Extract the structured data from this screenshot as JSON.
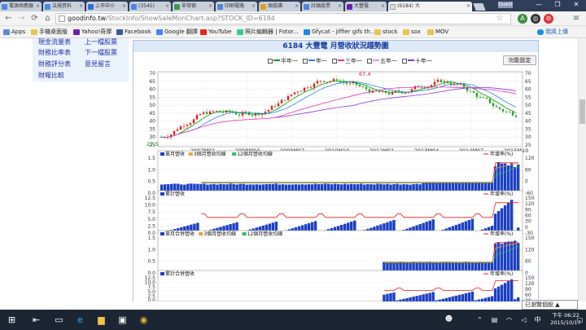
{
  "tabs": [
    {
      "label": "電源供應器"
    },
    {
      "label": "法規資料"
    },
    {
      "label": "上市中小"
    },
    {
      "label": "(3545)"
    },
    {
      "label": "非常宿"
    },
    {
      "label": "印刷電路"
    },
    {
      "label": "換股讀"
    },
    {
      "label": "討論股票"
    },
    {
      "label": "大豐電"
    },
    {
      "label": "(6184) 大"
    }
  ],
  "user_chip": "Guest",
  "window_controls": {
    "minimize": "—",
    "maximize": "❐",
    "close": "✕"
  },
  "address": {
    "host": "goodinfo.tw",
    "path": "/StockInfo/ShowSaleMonChart.asp?STOCK_ID=6184"
  },
  "toolbar_extra": {
    "sync_label": "我將上傳"
  },
  "bookmarks": [
    {
      "label": "Apps"
    },
    {
      "label": "手機桌面版"
    },
    {
      "label": "Yahoo!奇摩"
    },
    {
      "label": "Facebook"
    },
    {
      "label": "Google 翻譯"
    },
    {
      "label": "YouTube"
    },
    {
      "label": "照片編輯器 | Fotor..."
    },
    {
      "label": "Gfycat - jiffier gifs th..."
    },
    {
      "label": "stock"
    },
    {
      "label": "sox"
    },
    {
      "label": "MOV"
    }
  ],
  "sidebar": {
    "links": [
      {
        "label": "現金流量表"
      },
      {
        "label": "上一檔股票"
      },
      {
        "label": "財務比率表"
      },
      {
        "label": "下一檔股票"
      },
      {
        "label": "財務評分表"
      },
      {
        "label": "意見留言"
      },
      {
        "label": "財報比較"
      }
    ]
  },
  "chart": {
    "title": "6184 大豐電 月營收狀況趨勢圖",
    "settings_label": "功能設定",
    "legend": [
      {
        "label": "半年一",
        "color": "#009900"
      },
      {
        "label": "年一",
        "color": "#2a7fe0"
      },
      {
        "label": "三年一",
        "color": "#dd33aa"
      },
      {
        "label": "五年一",
        "color": "#d9a0d0"
      },
      {
        "label": "十年一",
        "color": "#8833dd"
      }
    ],
    "price_max_label": "67.4",
    "price_min_label": "27.5",
    "date_ticks": [
      "2007M01",
      "2008M04",
      "2009M07",
      "2010M10",
      "2012M01",
      "2013M04",
      "2014M07",
      "2015M10"
    ],
    "y_ticks_main": [
      "70",
      "65",
      "60",
      "55",
      "50",
      "45",
      "40",
      "35",
      "30",
      "25"
    ],
    "panels": [
      {
        "legend": [
          "單月營收",
          "3個月營收均線",
          "12個月營收均線"
        ],
        "right_legend": "年增率(%)",
        "y_left": [
          "1.5",
          "1.0",
          "0.5",
          "0.0"
        ],
        "y_right": [
          "120",
          "60",
          "0",
          "-60"
        ]
      },
      {
        "legend": [
          "累計營收"
        ],
        "right_legend": "年增率(%)",
        "y_left": [
          "12.5",
          "10.0",
          "7.5",
          "5.0",
          "2.5",
          "0.0"
        ],
        "y_right": [
          "150",
          "120",
          "90",
          "60",
          "30",
          "0",
          "-30"
        ]
      },
      {
        "legend": [
          "單月合併營收",
          "3個月營收均線",
          "12個月營收均線"
        ],
        "right_legend": "年增率(%)",
        "y_left": [
          "1.5",
          "1.0",
          "0.5",
          "0.0"
        ],
        "y_right": [
          "150",
          "120",
          "60",
          "0"
        ]
      },
      {
        "legend": [
          "累計合併營收"
        ],
        "right_legend": "年增率(%)",
        "y_left": [
          "12.5",
          "10.0",
          "7.5",
          "5.0",
          "2.5",
          "0.0"
        ],
        "y_right": [
          "150",
          "120",
          "90",
          "60",
          "30"
        ]
      }
    ]
  },
  "viewed_box": "已瀏覽個股 ▲",
  "clock": {
    "time": "下午 06:22",
    "date": "2015/10/17"
  },
  "colors": {
    "bar_blue": "#1a3fc4",
    "accent_red": "#e02020",
    "candle_red": "#e02020",
    "candle_green": "#2c9a2c"
  }
}
